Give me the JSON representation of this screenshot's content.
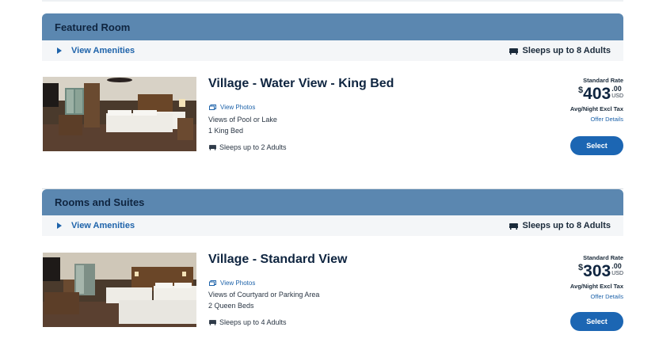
{
  "featured": {
    "title": "Featured Room",
    "amenities_label": "View Amenities",
    "sleeps_label": "Sleeps up to 8 Adults",
    "room": {
      "name": "Village - Water View - King Bed",
      "view_photos": "View Photos",
      "view": "Views of Pool or Lake",
      "beds": "1 King Bed",
      "sleeps": "Sleeps up to 2 Adults",
      "rate_label": "Standard Rate",
      "currency_symbol": "$",
      "price": "403",
      "cents": ".00",
      "currency": "USD",
      "avg_label": "Avg/Night Excl Tax",
      "offer_details": "Offer Details",
      "select_label": "Select"
    }
  },
  "rooms_suites": {
    "title": "Rooms and Suites",
    "amenities_label": "View Amenities",
    "sleeps_label": "Sleeps up to 8 Adults",
    "room": {
      "name": "Village - Standard View",
      "view_photos": "View Photos",
      "view": "Views of Courtyard or Parking Area",
      "beds": "2 Queen Beds",
      "sleeps": "Sleeps up to 4 Adults",
      "rate_label": "Standard Rate",
      "currency_symbol": "$",
      "price": "303",
      "cents": ".00",
      "currency": "USD",
      "avg_label": "Avg/Night Excl Tax",
      "offer_details": "Offer Details",
      "select_label": "Select"
    }
  },
  "colors": {
    "header_bg": "#5b87b0",
    "accent_blue": "#1c66b3",
    "amenity_bar_bg": "#f4f6f8"
  },
  "icons": [
    "play-triangle-icon",
    "bed-icon",
    "photo-gallery-icon"
  ]
}
